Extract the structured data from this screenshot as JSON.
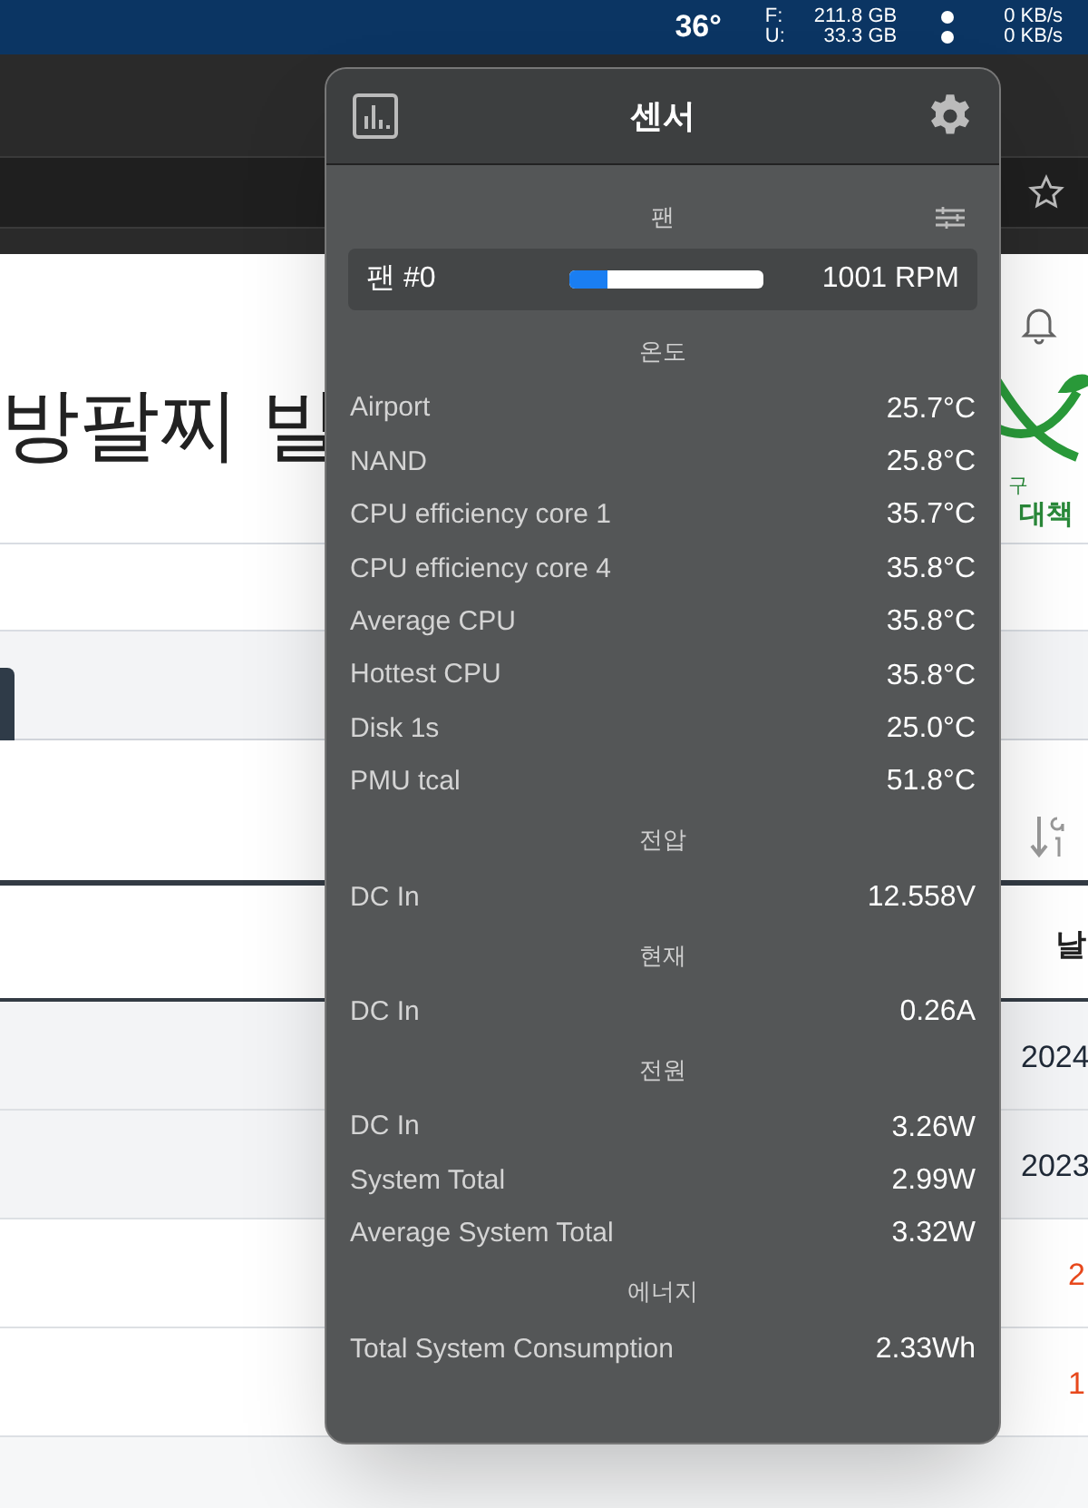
{
  "menubar": {
    "temperature": "36°",
    "disk": [
      {
        "label": "F:",
        "value": "211.8 GB"
      },
      {
        "label": "U:",
        "value": "33.3 GB"
      }
    ],
    "network": [
      {
        "value": "0 KB/s"
      },
      {
        "value": "0 KB/s"
      }
    ]
  },
  "page": {
    "title": "방팔찌 빌",
    "logo": [
      "구",
      "대책"
    ],
    "column_header": "날",
    "cells": [
      {
        "text": "2024",
        "color": "#1f2937"
      },
      {
        "text": "2023",
        "color": "#1f2937"
      },
      {
        "text": "2",
        "color": "#e8491d"
      },
      {
        "text": "1",
        "color": "#e8491d"
      }
    ]
  },
  "popup": {
    "title": "센서",
    "sections": [
      {
        "title": "팬",
        "rows": [
          {
            "kind": "fan",
            "label": "팬 #0",
            "level": 0.2,
            "value": "1001 RPM"
          }
        ]
      },
      {
        "title": "온도",
        "rows": [
          {
            "kind": "reading",
            "label": "Airport",
            "value": "25.7°C"
          },
          {
            "kind": "reading",
            "label": "NAND",
            "value": "25.8°C"
          },
          {
            "kind": "reading",
            "label": "CPU efficiency core 1",
            "value": "35.7°C"
          },
          {
            "kind": "reading",
            "label": "CPU efficiency core 4",
            "value": "35.8°C"
          },
          {
            "kind": "reading",
            "label": "Average CPU",
            "value": "35.8°C"
          },
          {
            "kind": "reading",
            "label": "Hottest CPU",
            "value": "35.8°C"
          },
          {
            "kind": "reading",
            "label": "Disk 1s",
            "value": "25.0°C"
          },
          {
            "kind": "reading",
            "label": "PMU tcal",
            "value": "51.8°C"
          }
        ]
      },
      {
        "title": "전압",
        "rows": [
          {
            "kind": "reading",
            "label": "DC In",
            "value": "12.558V"
          }
        ]
      },
      {
        "title": "현재",
        "rows": [
          {
            "kind": "reading",
            "label": "DC In",
            "value": "0.26A"
          }
        ]
      },
      {
        "title": "전원",
        "rows": [
          {
            "kind": "reading",
            "label": "DC In",
            "value": "3.26W"
          },
          {
            "kind": "reading",
            "label": "System Total",
            "value": "2.99W"
          },
          {
            "kind": "reading",
            "label": "Average System Total",
            "value": "3.32W"
          }
        ]
      },
      {
        "title": "에너지",
        "rows": [
          {
            "kind": "reading",
            "label": "Total System Consumption",
            "value": "2.33Wh"
          }
        ]
      }
    ]
  }
}
